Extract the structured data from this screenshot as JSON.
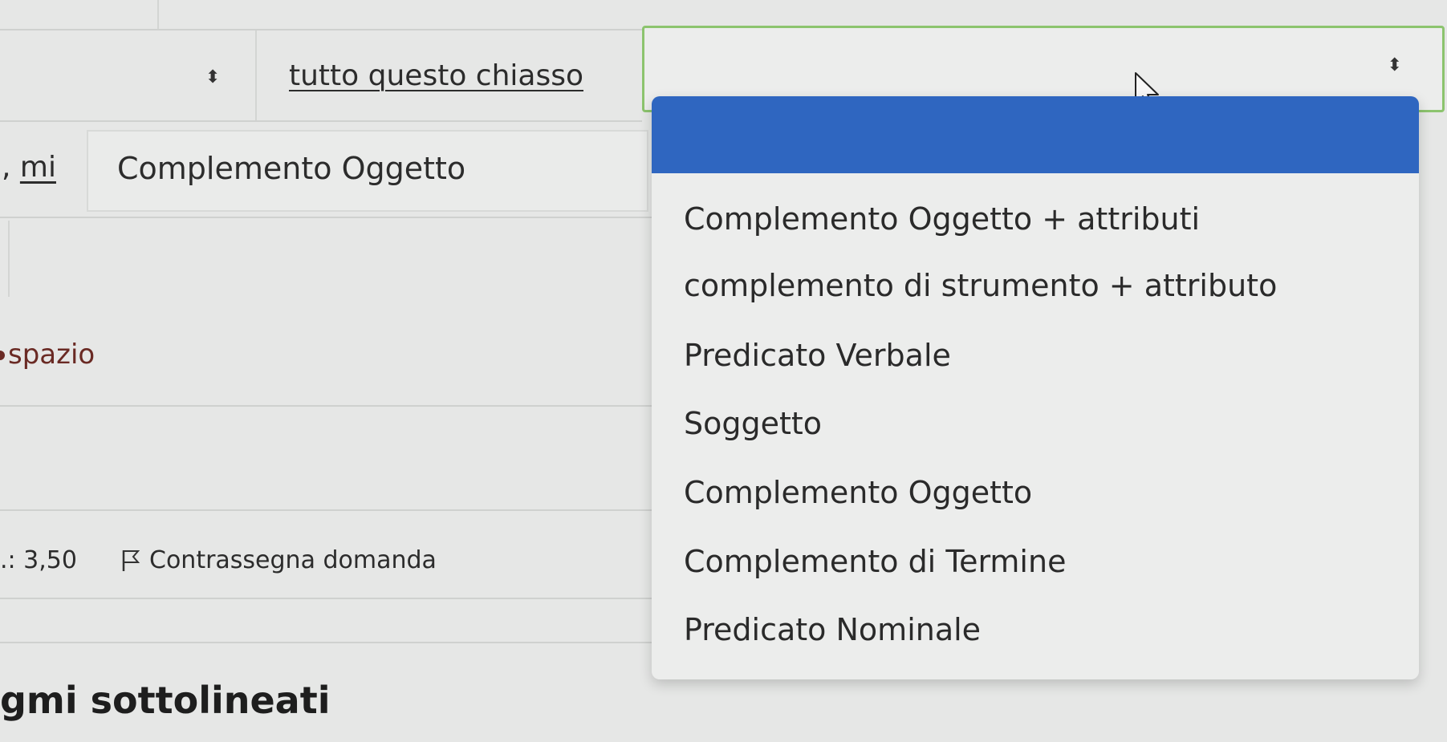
{
  "top_row": {
    "stepper_glyph": "⬍",
    "phrase": "tutto questo chiasso"
  },
  "select": {
    "current_value": "",
    "stepper_glyph": "⬍"
  },
  "row_mi": {
    "prefix": ", ",
    "word": "mi",
    "answer": "Complemento Oggetto"
  },
  "row_spazio": {
    "text": "spazio"
  },
  "footer": {
    "score": ".: 3,50",
    "flag_label": "Contrassegna domanda"
  },
  "heading": "gmi sottolineati",
  "dropdown": {
    "options": [
      "",
      "Complemento Oggetto + attributi",
      "complemento di strumento + attributo",
      "Predicato Verbale",
      "Soggetto",
      "Complemento Oggetto",
      "Complemento di Termine",
      "Predicato Nominale"
    ],
    "selected_index": 0,
    "highlight_color": "#2f66c0"
  },
  "colors": {
    "select_border": "#8cc46e",
    "spazio_text": "#6a2a24"
  }
}
